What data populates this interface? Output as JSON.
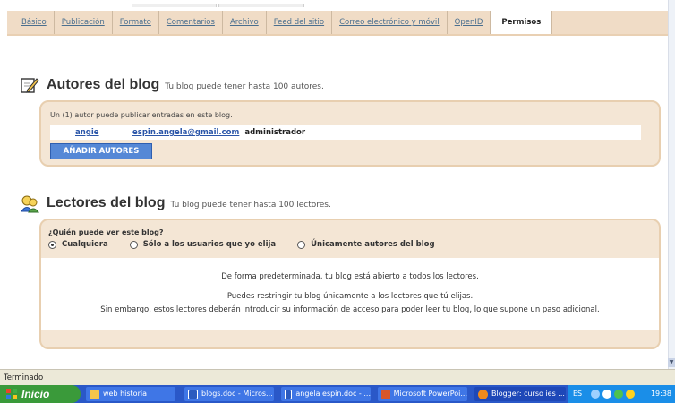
{
  "tabs": [
    {
      "label": "Básico"
    },
    {
      "label": "Publicación"
    },
    {
      "label": "Formato"
    },
    {
      "label": "Comentarios"
    },
    {
      "label": "Archivo"
    },
    {
      "label": "Feed del sitio"
    },
    {
      "label": "Correo electrónico y móvil"
    },
    {
      "label": "OpenID"
    },
    {
      "label": "Permisos"
    }
  ],
  "active_tab": "Permisos",
  "authors": {
    "title": "Autores del blog",
    "subtitle": "Tu blog puede tener hasta 100 autores.",
    "note": "Un (1) autor puede publicar entradas en este blog.",
    "rows": [
      {
        "name": "angie",
        "email": "espin.angela@gmail.com",
        "role": "administrador"
      }
    ],
    "add_button": "AÑADIR AUTORES"
  },
  "readers": {
    "title": "Lectores del blog",
    "subtitle": "Tu blog puede tener hasta 100 lectores.",
    "question": "¿Quién puede ver este blog?",
    "options": [
      {
        "label": "Cualquiera",
        "selected": true
      },
      {
        "label": "Sólo a los usuarios que yo elija",
        "selected": false
      },
      {
        "label": "Únicamente autores del blog",
        "selected": false
      }
    ],
    "info_1": "De forma predeterminada, tu blog está abierto a todos los lectores.",
    "info_2": "Puedes restringir tu blog únicamente a los lectores que tú elijas.",
    "info_3": "Sin embargo, estos lectores deberán introducir su información de acceso para poder leer tu blog, lo que supone un paso adicional."
  },
  "status_bar": {
    "text": "Terminado"
  },
  "taskbar": {
    "start": "Inicio",
    "items": [
      {
        "label": "web historia",
        "icon": "folder-icon"
      },
      {
        "label": "blogs.doc - Micros...",
        "icon": "word-icon"
      },
      {
        "label": "angela espin.doc - ...",
        "icon": "word-icon"
      },
      {
        "label": "Microsoft PowerPoi...",
        "icon": "powerpoint-icon"
      },
      {
        "label": "Blogger: curso ies ...",
        "icon": "firefox-icon"
      }
    ],
    "lang": "ES",
    "clock": "19:38"
  },
  "colors": {
    "tab_bg": "#f0dcc6",
    "panel_bg": "#f4e6d5",
    "panel_border": "#e8cfb0",
    "link": "#2a55a8",
    "button": "#5588d6",
    "taskbar": "#2a58c8",
    "start": "#3a9a3a"
  }
}
